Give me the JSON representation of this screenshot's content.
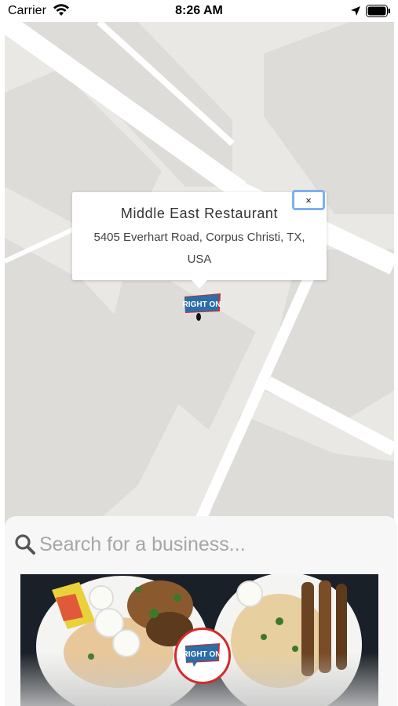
{
  "status_bar": {
    "carrier": "Carrier",
    "time": "8:26 AM",
    "icons": [
      "wifi-icon",
      "location-arrow-icon",
      "battery-icon"
    ]
  },
  "map": {
    "popup": {
      "title": "Middle East Restaurant",
      "address": "5405 Everhart Road, Corpus Christi, TX, USA",
      "close_label": "×"
    },
    "marker_logo_text": "RIGHT ON"
  },
  "search": {
    "placeholder": "Search for a business...",
    "icon": "search-icon"
  },
  "featured": {
    "logo_text": "RIGHT ON",
    "image_subject": "food-plates"
  },
  "colors": {
    "map_background": "#e9e8e5",
    "map_block": "#dddcd9",
    "road": "#ffffff",
    "close_border": "#7fb0ee",
    "badge_border": "#d32b2b",
    "logo_blue": "#2c6ea8",
    "logo_red": "#d32b2b"
  }
}
